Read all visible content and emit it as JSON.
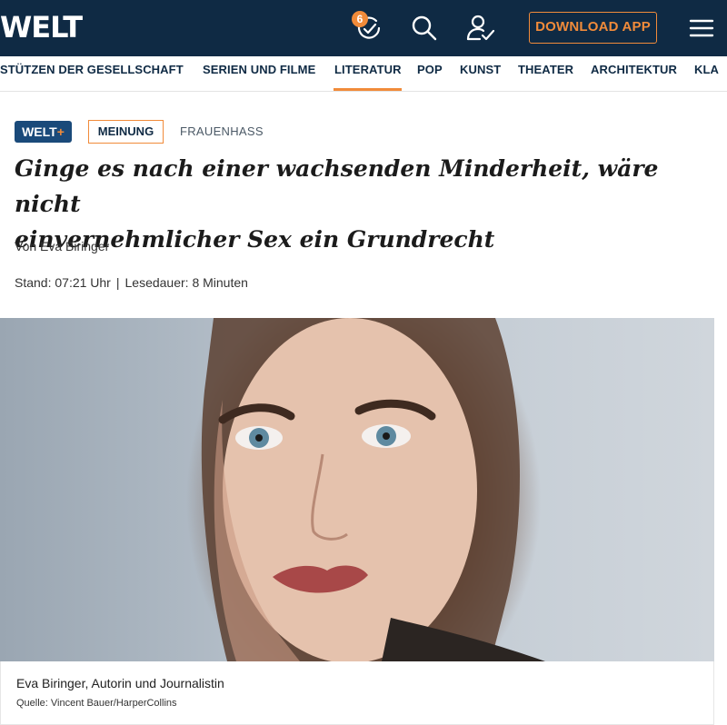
{
  "header": {
    "logo": "WELT",
    "notification_count": "6",
    "download_label": "DOWNLOAD APP"
  },
  "nav": {
    "items": [
      {
        "label": "STÜTZEN DER GESELLSCHAFT"
      },
      {
        "label": "SERIEN UND FILME"
      },
      {
        "label": "LITERATUR"
      },
      {
        "label": "POP"
      },
      {
        "label": "KUNST"
      },
      {
        "label": "THEATER"
      },
      {
        "label": "ARCHITEKTUR"
      },
      {
        "label": "KLA"
      }
    ],
    "active": "LITERATUR"
  },
  "article": {
    "badge_welt": "WELT",
    "badge_plus": "+",
    "category": "MEINUNG",
    "topic": "FRAUENHASS",
    "headline_line1": "Ginge es nach einer wachsenden Minderheit, wäre nicht",
    "headline_line2": "einvernehmlicher Sex ein Grundrecht",
    "byline": "Von Eva Biringer",
    "stand": "Stand: 07:21 Uhr",
    "separator": "|",
    "read_time": "Lesedauer: 8 Minuten"
  },
  "image": {
    "caption": "Eva Biringer, Autorin und Journalistin",
    "credit": "Quelle: Vincent Bauer/HarperCollins"
  },
  "colors": {
    "header_bg": "#0f2a44",
    "accent": "#f18b3a",
    "welt_plus_bg": "#1a4a7a"
  }
}
